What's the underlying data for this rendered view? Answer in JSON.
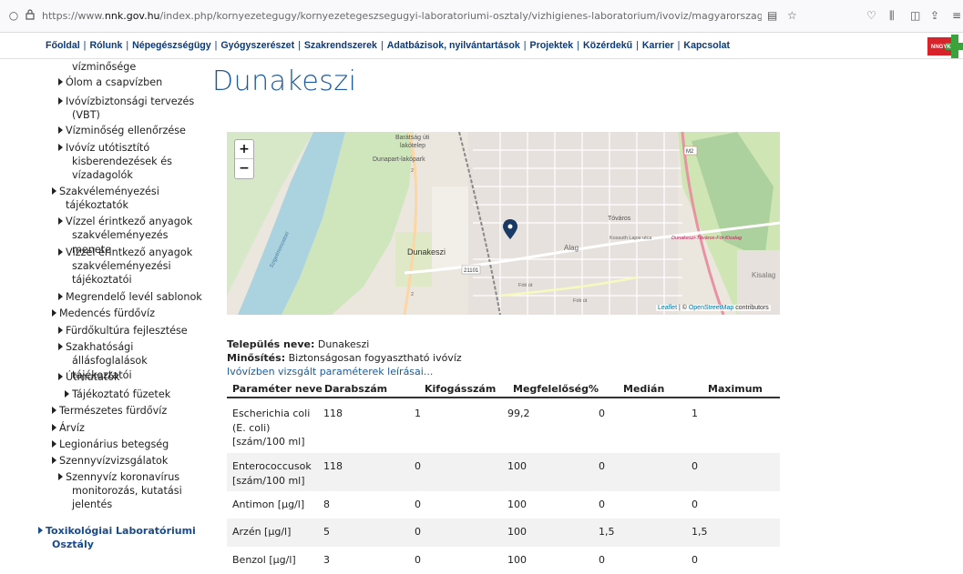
{
  "browser": {
    "url_prefix": "https://www.",
    "url_domain": "nnk.gov.hu",
    "url_path": "/index.php/kornyezetegugy/kornyezetegeszsegugyi-laboratoriumi-osztaly/vizhigienes-laboratorium/ivoviz/magyarorszagi-telepulesek-ivovizm"
  },
  "topnav": {
    "items": [
      "Főoldal",
      "Rólunk",
      "Népegészségügy",
      "Gyógyszerészet",
      "Szakrendszerek",
      "Adatbázisok, nyilvántartások",
      "Projektek",
      "Közérdekű",
      "Karrier",
      "Kapcsolat"
    ],
    "logo_text": "NNGYK"
  },
  "sidebar": {
    "items": [
      {
        "label": "vízminősége",
        "tri": false
      },
      {
        "label": "Ólom a csapvízben",
        "tri": true
      },
      {
        "label": "Ivóvízbiztonsági tervezés",
        "tri": true
      },
      {
        "label": "(VBT)",
        "tri": false
      },
      {
        "label": "Vízminőség ellenőrzése",
        "tri": true
      },
      {
        "label": "Ivóvíz utótisztító",
        "tri": true
      },
      {
        "label": "kisberendezések és",
        "tri": false
      },
      {
        "label": "vízadagolók",
        "tri": false
      },
      {
        "label": "Szakvéleményezési",
        "tri": true
      },
      {
        "label": "tájékoztatók",
        "tri": false
      },
      {
        "label": "Vízzel érintkező anyagok",
        "tri": true
      },
      {
        "label": "szakvéleményezés menete",
        "tri": false
      },
      {
        "label": "Vízzel érintkező anyagok",
        "tri": true
      },
      {
        "label": "szakvéleményezési",
        "tri": false
      },
      {
        "label": "tájékoztatói",
        "tri": false
      },
      {
        "label": "Megrendelő levél sablonok",
        "tri": true
      },
      {
        "label": "Medencés fürdővíz",
        "tri": true
      },
      {
        "label": "Fürdőkultúra fejlesztése",
        "tri": true
      },
      {
        "label": "Szakhatósági",
        "tri": true
      },
      {
        "label": "állásfoglalások tájékoztatói",
        "tri": false
      },
      {
        "label": "Útmutatók",
        "tri": true
      },
      {
        "label": "Tájékoztató füzetek",
        "tri": true
      },
      {
        "label": "Természetes fürdővíz",
        "tri": true
      },
      {
        "label": "Árvíz",
        "tri": true
      },
      {
        "label": "Legionárius betegség",
        "tri": true
      },
      {
        "label": "Szennyvízvizsgálatok",
        "tri": true
      },
      {
        "label": "Szennyvíz koronavírus",
        "tri": true
      },
      {
        "label": "monitorozás, kutatási",
        "tri": false
      },
      {
        "label": "jelentés",
        "tri": false
      },
      {
        "label": "Toxikológiai Laboratóriumi",
        "tri": true
      },
      {
        "label": "Osztály",
        "tri": false
      }
    ]
  },
  "page": {
    "title": "Dunakeszi"
  },
  "map": {
    "zoom_in": "+",
    "zoom_out": "−",
    "labels": {
      "baratsag": "Barátság úti",
      "lakotelep": "lakótelep",
      "dunapart": "Dunapart-lakópark",
      "dunakeszi": "Dunakeszi",
      "tovaros": "Tóváros",
      "alag": "Alag",
      "kossuth": "Kossuth Lajos utca",
      "fot": "Dunakeszi-Tóváros-Fót-Kisalag",
      "kisalag": "Kisalag",
      "road21101": "21101",
      "m2": "M2",
      "szigetmonostor": "Szigetmonostori",
      "foti": "Fóti út",
      "foti2": "Fóti út",
      "r2": "2",
      "r2b": "2"
    },
    "attribution_leaflet": "Leaflet",
    "attribution_sep": " | © ",
    "attribution_osm": "OpenStreetMap",
    "attribution_tail": " contributors"
  },
  "info": {
    "settlement_label": "Település neve:",
    "settlement_value": " Dunakeszi",
    "rating_label": "Minősítés:",
    "rating_value": " Biztonságosan fogyasztható ivóvíz",
    "params_link": "Ivóvízben vizsgált paraméterek leírásai..."
  },
  "table": {
    "headers": [
      "Paraméter neve",
      "Darabszám",
      "Kifogásszám",
      "Megfelelőség%",
      "Medián",
      "Maximum"
    ],
    "rows": [
      {
        "name": [
          "Escherichia coli",
          "(E. coli)",
          "[szám/100 ml]"
        ],
        "count": "118",
        "objections": "1",
        "compliance": "99,2",
        "median": "0",
        "max": "1"
      },
      {
        "name": [
          "Enterococcusok",
          "[szám/100 ml]"
        ],
        "count": "118",
        "objections": "0",
        "compliance": "100",
        "median": "0",
        "max": "0"
      },
      {
        "name": [
          "Antimon [µg/l]"
        ],
        "count": "8",
        "objections": "0",
        "compliance": "100",
        "median": "0",
        "max": "0"
      },
      {
        "name": [
          "Arzén [µg/l]"
        ],
        "count": "5",
        "objections": "0",
        "compliance": "100",
        "median": "1,5",
        "max": "1,5"
      },
      {
        "name": [
          "Benzol [µg/l]"
        ],
        "count": "3",
        "objections": "0",
        "compliance": "100",
        "median": "0",
        "max": "0"
      }
    ]
  }
}
